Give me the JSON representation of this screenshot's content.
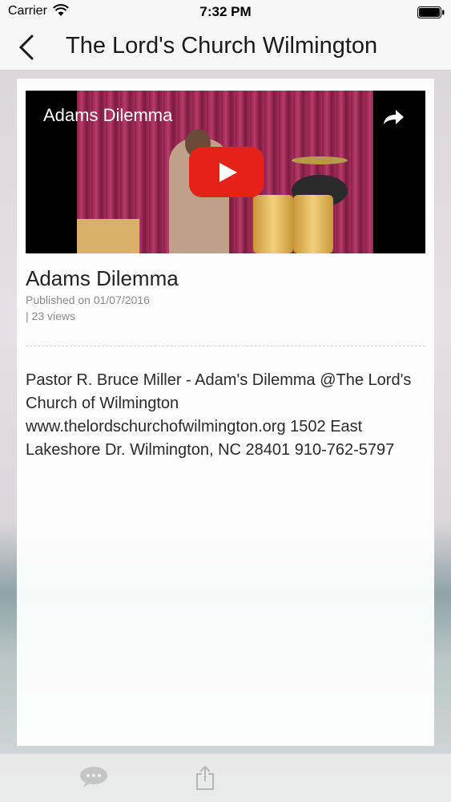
{
  "status_bar": {
    "carrier": "Carrier",
    "time": "7:32 PM",
    "icons": [
      "wifi-icon",
      "battery-icon"
    ]
  },
  "nav": {
    "title": "The Lord's Church Wilmington",
    "back_icon": "chevron-left-icon"
  },
  "video": {
    "overlay_title": "Adams Dilemma",
    "play_icon": "play-icon",
    "share_icon": "share-arrow-icon",
    "play_button_color": "#e62117"
  },
  "details": {
    "title": "Adams Dilemma",
    "published": "Published on 01/07/2016",
    "views": "| 23 views",
    "description": "Pastor R. Bruce Miller - Adam's Dilemma @The Lord's Church of Wilmington www.thelordschurchofwilmington.org 1502 East Lakeshore Dr. Wilmington, NC 28401 910-762-5797"
  },
  "toolbar": {
    "icons": [
      "comment-icon",
      "share-icon"
    ]
  }
}
